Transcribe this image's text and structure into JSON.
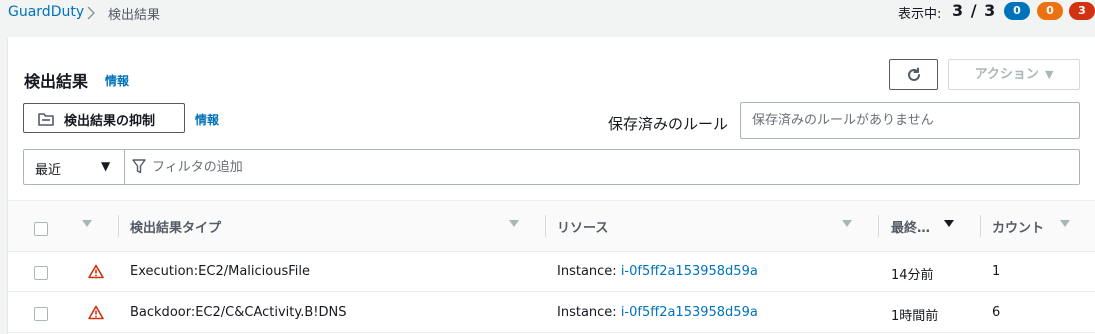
{
  "breadcrumb": {
    "root": "GuardDuty",
    "current": "検出結果"
  },
  "showing": {
    "label": "表示中:",
    "value": "3 / 3"
  },
  "badges": [
    {
      "count": "0",
      "color": "#0073bb"
    },
    {
      "count": "0",
      "color": "#ec7211"
    },
    {
      "count": "3",
      "color": "#d13212"
    }
  ],
  "header": {
    "title": "検出結果",
    "info": "情報"
  },
  "actions": {
    "refresh_icon": "refresh-icon",
    "action_label": "アクション"
  },
  "suppress": {
    "label": "検出結果の抑制",
    "info": "情報"
  },
  "saved_rules": {
    "label": "保存済みのルール",
    "placeholder": "保存済みのルールがありません"
  },
  "filter": {
    "range": "最近",
    "placeholder": "フィルタの追加"
  },
  "table": {
    "columns": [
      "検出結果タイプ",
      "リソース",
      "最終…",
      "カウント"
    ],
    "rows": [
      {
        "type": "Execution:EC2/MaliciousFile",
        "resource_prefix": "Instance: ",
        "resource_id": "i-0f5ff2a153958d59a",
        "last": "14分前",
        "count": "1"
      },
      {
        "type": "Backdoor:EC2/C&CActivity.B!DNS",
        "resource_prefix": "Instance: ",
        "resource_id": "i-0f5ff2a153958d59a",
        "last": "1時間前",
        "count": "6"
      }
    ]
  },
  "colors": {
    "link": "#0073bb",
    "severity_high": "#d13212"
  }
}
